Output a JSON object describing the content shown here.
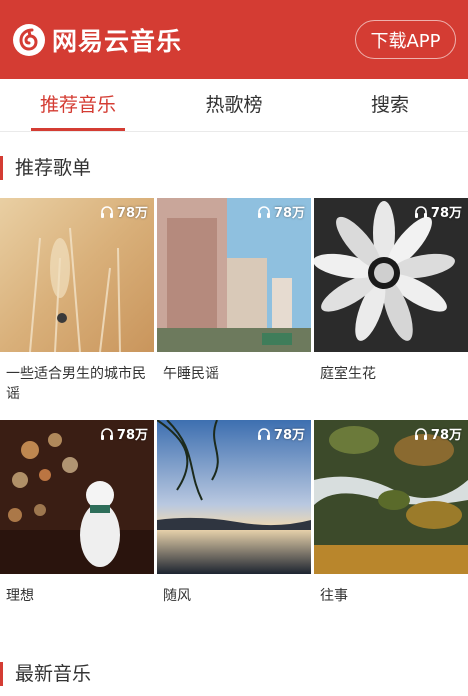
{
  "header": {
    "logo_text": "网易云音乐",
    "download_label": "下载APP",
    "accent_color": "#d43c33"
  },
  "tabs": [
    {
      "label": "推荐音乐",
      "active": true
    },
    {
      "label": "热歌榜",
      "active": false
    },
    {
      "label": "搜索",
      "active": false
    }
  ],
  "sections": {
    "recommended": "推荐歌单",
    "newest": "最新音乐"
  },
  "playlists": [
    {
      "title": "一些适合男生的城市民谣",
      "plays": "78万",
      "icon": "headphones-icon"
    },
    {
      "title": "午睡民谣",
      "plays": "78万",
      "icon": "headphones-icon"
    },
    {
      "title": "庭室生花",
      "plays": "78万",
      "icon": "headphones-icon"
    },
    {
      "title": "理想",
      "plays": "78万",
      "icon": "headphones-icon"
    },
    {
      "title": "随风",
      "plays": "78万",
      "icon": "headphones-icon"
    },
    {
      "title": "往事",
      "plays": "78万",
      "icon": "headphones-icon"
    }
  ]
}
